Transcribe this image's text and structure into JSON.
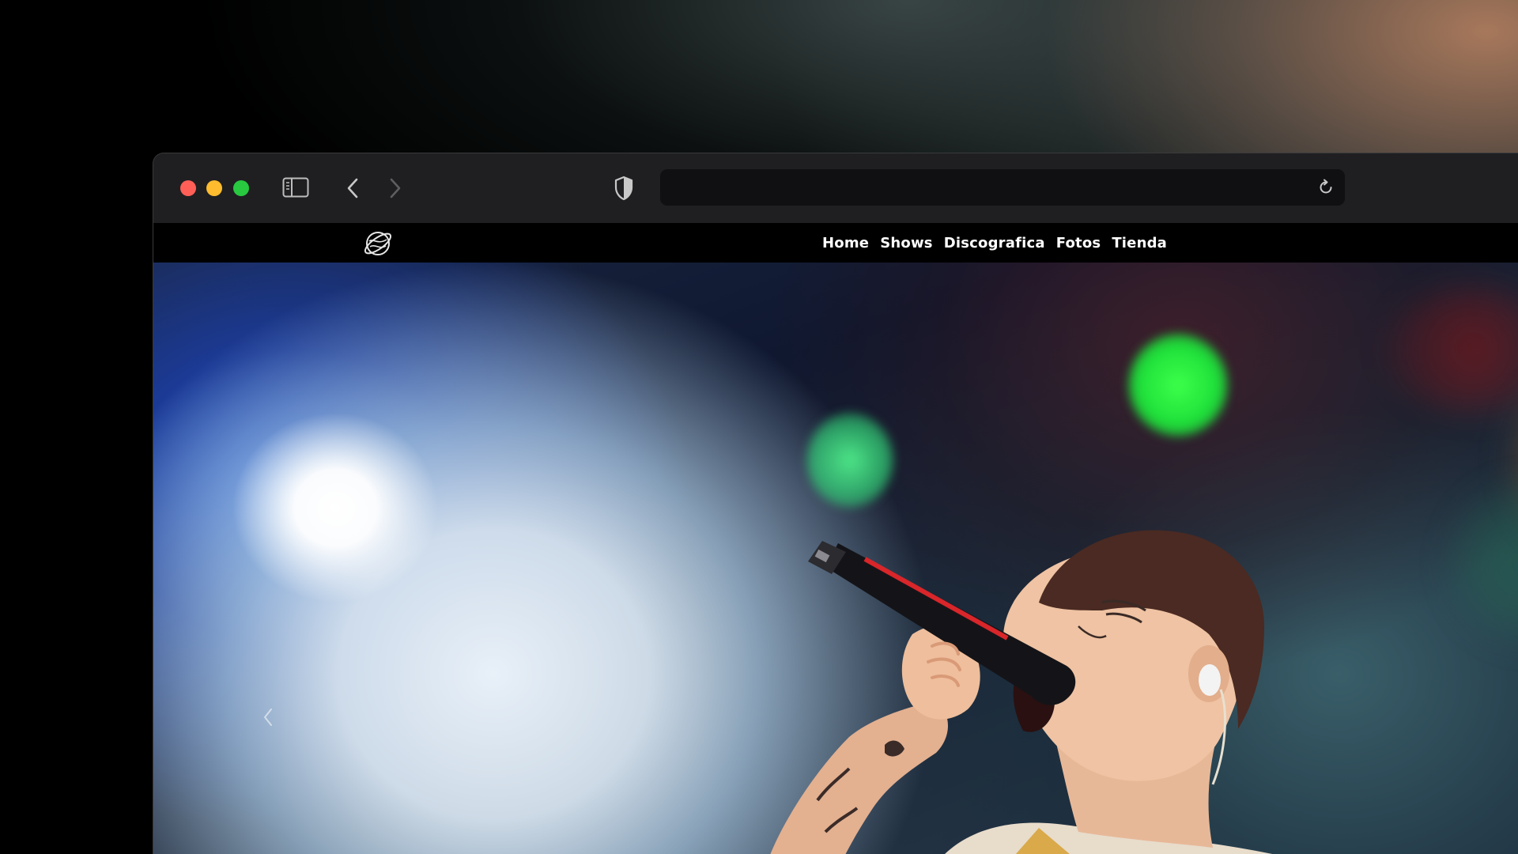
{
  "browser": {
    "url": "",
    "icons": {
      "sidebar": "sidebar-icon",
      "back": "chevron-left-icon",
      "forward": "chevron-right-icon",
      "privacy": "shield-icon",
      "reload": "reload-icon"
    },
    "traffic_lights": {
      "close": "#ff5f57",
      "minimize": "#febc2e",
      "zoom": "#28c840"
    }
  },
  "site": {
    "logo": "planet-logo-icon",
    "nav": [
      {
        "label": "Home"
      },
      {
        "label": "Shows"
      },
      {
        "label": "Discografica"
      },
      {
        "label": "Fotos"
      },
      {
        "label": "Tienda"
      }
    ],
    "hero": {
      "image": "singer-performing-with-microphone",
      "carousel_prev_icon": "chevron-left-icon"
    }
  }
}
